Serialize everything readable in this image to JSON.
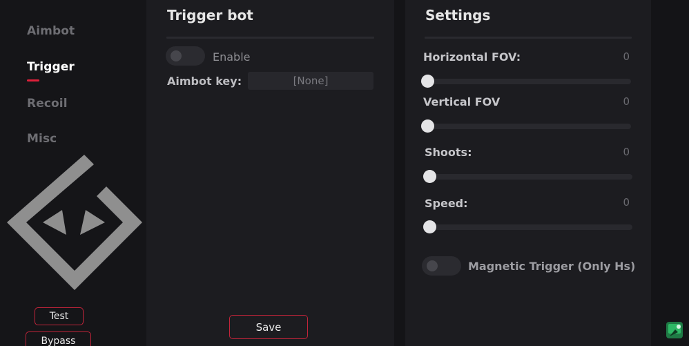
{
  "sidebar": {
    "items": [
      {
        "label": "Aimbot"
      },
      {
        "label": "Trigger"
      },
      {
        "label": "Recoil"
      },
      {
        "label": "Misc"
      }
    ],
    "active_index": 1,
    "buttons": {
      "test": "Test",
      "bypass": "Bypass"
    }
  },
  "trigger_panel": {
    "title": "Trigger bot",
    "enable_label": "Enable",
    "aimbot_key_label": "Aimbot key:",
    "aimbot_key_value": "[None]",
    "save_label": "Save"
  },
  "settings_panel": {
    "title": "Settings",
    "sliders": [
      {
        "label": "Horizontal FOV:",
        "value": "0"
      },
      {
        "label": "Vertical FOV",
        "value": "0"
      },
      {
        "label": "Shoots:",
        "value": "0"
      },
      {
        "label": "Speed:",
        "value": "0"
      }
    ],
    "magnetic_label": "Magnetic Trigger (Only Hs)"
  },
  "colors": {
    "accent": "#e0203a",
    "button_border": "#c3243a",
    "background": "#141417",
    "panel": "#1c1c20"
  },
  "icons": [
    "logo-icon",
    "tray-app-icon"
  ]
}
